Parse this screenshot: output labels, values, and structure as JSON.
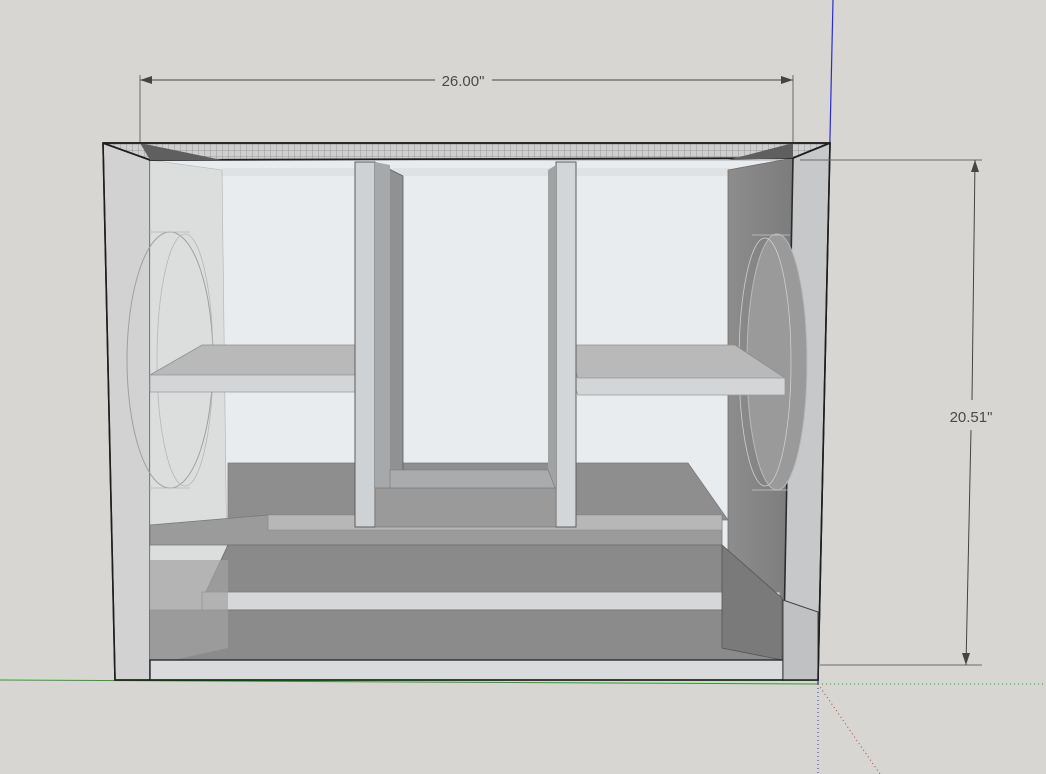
{
  "viewport": {
    "background_color": "#d7d6d2",
    "axis_colors": {
      "red": "#c23b3b",
      "green": "#29a329",
      "blue": "#2b2bd6"
    }
  },
  "model": {
    "name": "speaker-box",
    "dimensions": [
      {
        "id": "width",
        "label": "26.00\""
      },
      {
        "id": "height",
        "label": "20.51\""
      }
    ]
  }
}
